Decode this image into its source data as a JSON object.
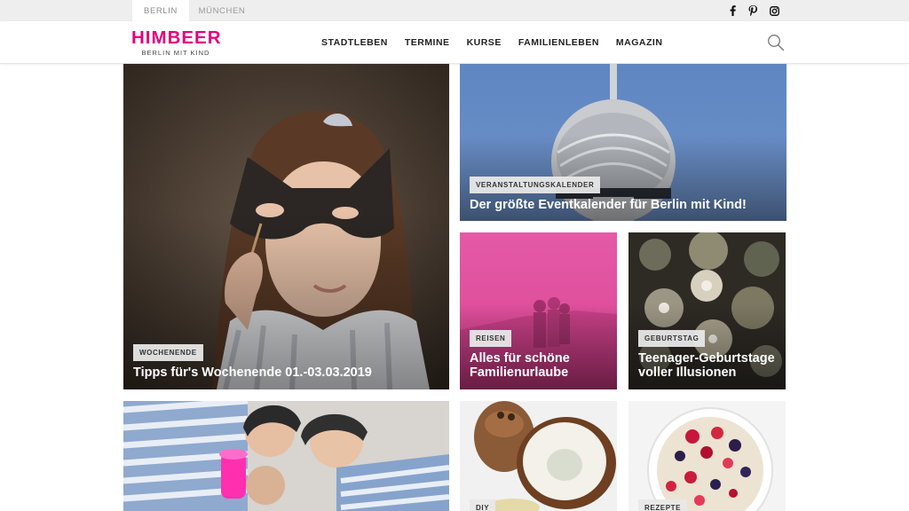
{
  "topbar": {
    "cities": [
      "BERLIN",
      "MÜNCHEN"
    ],
    "active_city": "BERLIN",
    "social": [
      "facebook-icon",
      "pinterest-icon",
      "instagram-icon"
    ]
  },
  "header": {
    "logo_main": "HIMBEER",
    "logo_sub": "BERLIN MIT KIND",
    "nav": [
      "STADTLEBEN",
      "TERMINE",
      "KURSE",
      "FAMILIENLEBEN",
      "MAGAZIN"
    ],
    "search_icon": "search-icon"
  },
  "colors": {
    "brand": "#e6007e",
    "badge_bg": "#e8e8e8",
    "topbar_bg": "#eeeeee"
  },
  "tiles": [
    {
      "badge": "WOCHENENDE",
      "title": "Tipps für's Wochenende 01.-03.03.2019"
    },
    {
      "badge": "VERANSTALTUNGSKALENDER",
      "title": "Der größte Eventkalender für Berlin mit Kind!"
    },
    {
      "badge": "REISEN",
      "title": "Alles für schöne Familienurlaube"
    },
    {
      "badge": "GEBURTSTAG",
      "title": "Teenager-Geburtstage voller Illusionen"
    },
    {
      "badge": "",
      "title": ""
    },
    {
      "badge": "DIY",
      "title": ""
    },
    {
      "badge": "REZEPTE",
      "title": ""
    }
  ]
}
